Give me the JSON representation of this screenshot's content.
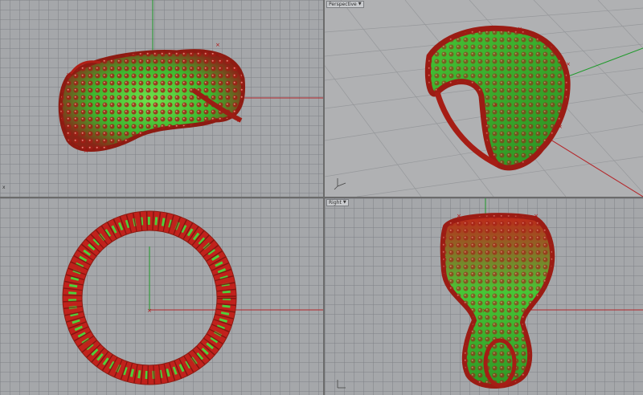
{
  "viewports": {
    "top": {
      "corner_text": "x"
    },
    "perspective": {
      "label": "Perspective"
    },
    "right": {
      "label": "Right"
    }
  },
  "colors": {
    "background": "#a5a7aa",
    "grid": "#83858a",
    "axis_x": "#b4262a",
    "axis_y": "#1e9a2a",
    "mesh_green": "#4fcf3a",
    "sphere_red": "#c21a14"
  }
}
